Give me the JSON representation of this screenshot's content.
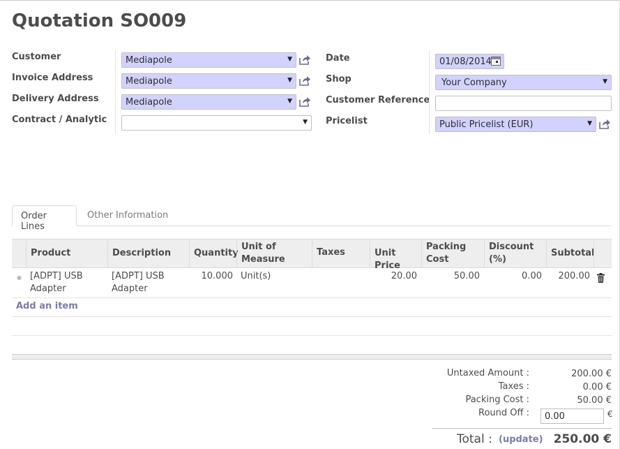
{
  "title": "Quotation SO009",
  "form": {
    "customer": {
      "label": "Customer",
      "value": "Mediapole"
    },
    "invoice_address": {
      "label": "Invoice Address",
      "value": "Mediapole"
    },
    "delivery_address": {
      "label": "Delivery Address",
      "value": "Mediapole"
    },
    "contract": {
      "label": "Contract / Analytic",
      "value": ""
    },
    "date": {
      "label": "Date",
      "value": "01/08/2014"
    },
    "shop": {
      "label": "Shop",
      "value": "Your Company"
    },
    "customer_reference": {
      "label": "Customer Reference",
      "value": ""
    },
    "pricelist": {
      "label": "Pricelist",
      "value": "Public Pricelist (EUR)"
    }
  },
  "tabs": [
    {
      "label": "Order Lines",
      "active": true
    },
    {
      "label": "Other Information",
      "active": false
    }
  ],
  "table": {
    "headers": [
      "Product",
      "Description",
      "Quantity",
      "Unit of Measure",
      "Taxes",
      "Unit Price",
      "Packing Cost",
      "Discount (%)",
      "Subtotal"
    ],
    "rows": [
      {
        "product": "[ADPT] USB Adapter",
        "description": "[ADPT] USB Adapter",
        "quantity": "10.000",
        "uom": "Unit(s)",
        "taxes": "",
        "unit_price": "20.00",
        "packing_cost": "50.00",
        "discount": "0.00",
        "subtotal": "200.00"
      }
    ],
    "add_item_label": "Add an item"
  },
  "totals": {
    "untaxed_label": "Untaxed Amount :",
    "untaxed_value": "200.00 €",
    "taxes_label": "Taxes :",
    "taxes_value": "0.00 €",
    "packing_label": "Packing Cost :",
    "packing_value": "50.00 €",
    "roundoff_label": "Round Off :",
    "roundoff_value": "0.00",
    "roundoff_currency": "€",
    "total_label": "Total :",
    "update_label": "(update)",
    "total_value": "250.00 €"
  },
  "colors": {
    "required_field": "#d2d2ff",
    "link": "#7c7bad",
    "text": "#4c4c4c"
  },
  "icons": {
    "external_link": "external-link-icon",
    "dropdown": "dropdown-arrow-icon",
    "calendar": "calendar-icon",
    "delete": "trash-icon"
  }
}
